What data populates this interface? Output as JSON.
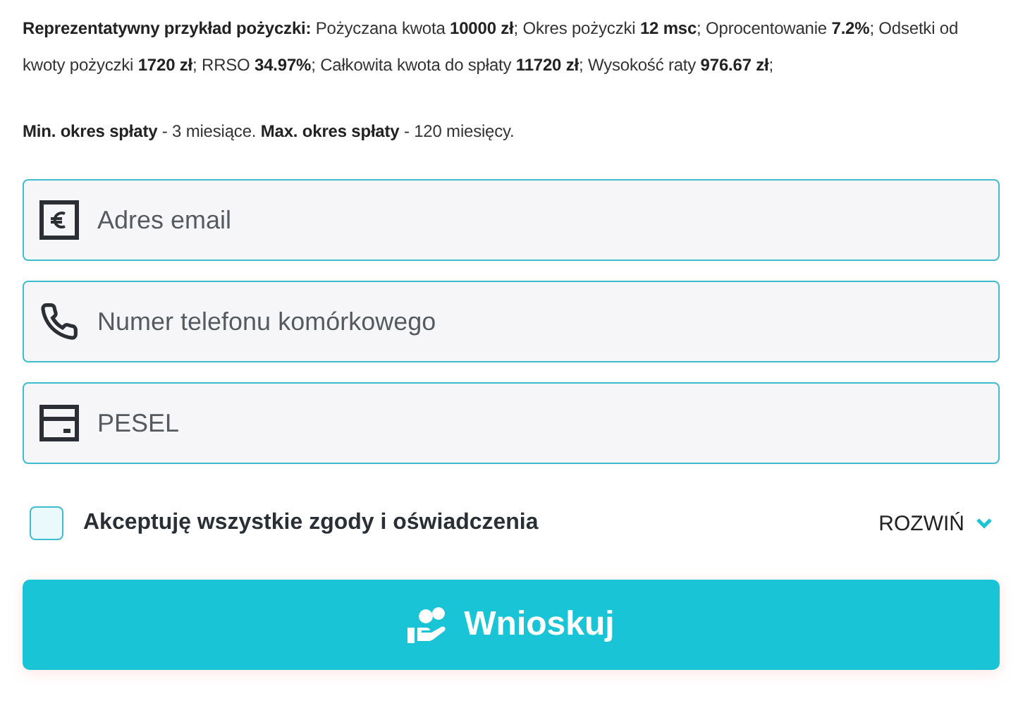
{
  "loan_info": {
    "example": "**Reprezentatywny przykład pożyczki:** Pożyczana kwota **10000 zł**; Okres pożyczki **12 msc**; Oprocentowanie **7.2%**; Odsetki od kwoty pożyczki **1720 zł**; RRSO **34.97%**; Całkowita kwota do spłaty **11720 zł**; Wysokość raty **976.67 zł**;",
    "terms": "**Min. okres spłaty** - 3 miesiące. **Max. okres spłaty** - 120 miesięcy."
  },
  "fields": [
    {
      "kind": "email",
      "placeholder": "Adres email"
    },
    {
      "kind": "phone",
      "placeholder": "Numer telefonu komórkowego"
    },
    {
      "kind": "id",
      "placeholder": "PESEL"
    }
  ],
  "consent": {
    "label": "Akceptuję wszystkie zgody i oświadczenia",
    "checked": false,
    "expand_label": "ROZWIŃ",
    "expanded": false
  },
  "submit": {
    "label": "Wnioskuj"
  }
}
